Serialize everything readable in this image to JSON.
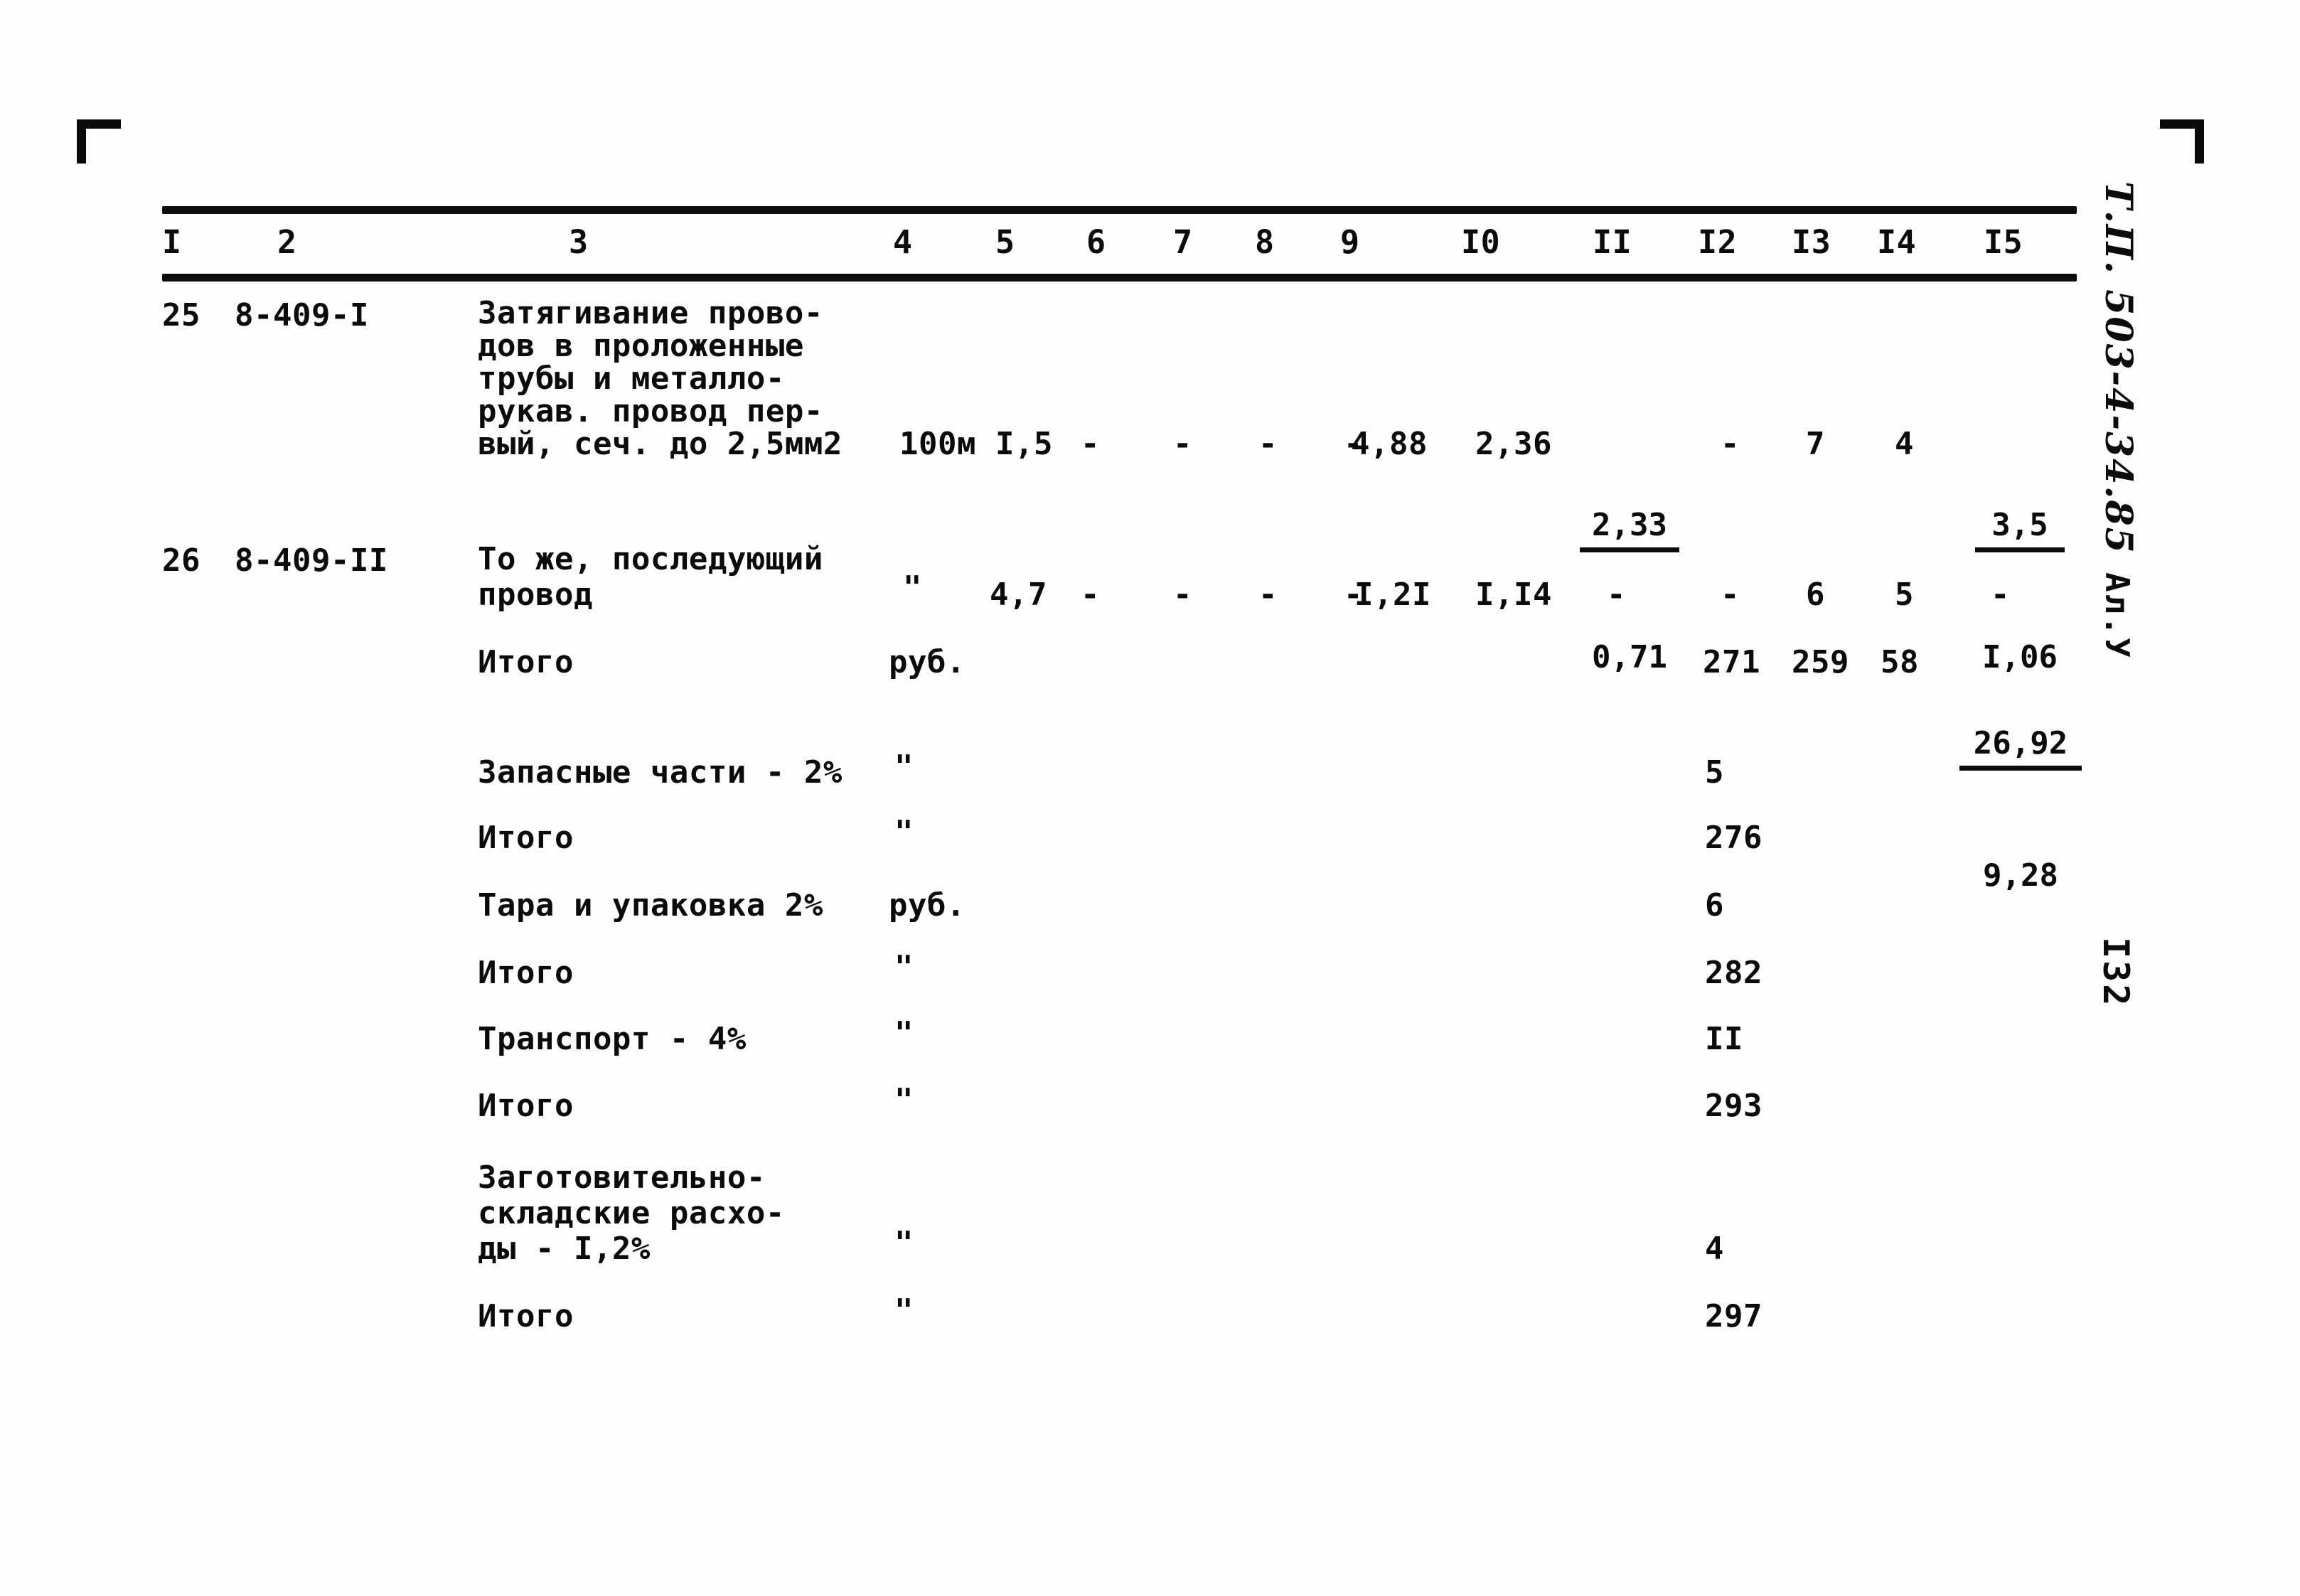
{
  "document": {
    "stamp": "Т.П. 503-4-34.85",
    "sheet_label": "Ал.У",
    "page_number": "I32"
  },
  "table": {
    "column_headers": [
      "I",
      "2",
      "3",
      "4",
      "5",
      "6",
      "7",
      "8",
      "9",
      "I0",
      "II",
      "I2",
      "I3",
      "I4",
      "I5"
    ],
    "rows": [
      {
        "no": "25",
        "code": "8-409-I",
        "description_lines": [
          "Затягивание прово-",
          "дов в проложенные",
          "трубы и металло-",
          "рукав. провод пер-",
          "вый, сеч. до 2,5мм2"
        ],
        "unit": "100м",
        "c5": "I,5",
        "c6": "-",
        "c7": "-",
        "c8": "-",
        "c9": "-",
        "c10": "4,88",
        "c11": "2,36",
        "c12_num": "2,33",
        "c12_den": "0,71",
        "c13": "-",
        "c14": "7",
        "c15": "4",
        "c16_num": "3,5",
        "c16_den": "I,06"
      },
      {
        "no": "26",
        "code": "8-409-II",
        "description_lines": [
          "То же, последующий",
          "провод"
        ],
        "unit": "\"",
        "c5": "4,7",
        "c6": "-",
        "c7": "-",
        "c8": "-",
        "c9": "-",
        "c10": "I,2I",
        "c11": "I,I4",
        "c12": "-",
        "c13": "-",
        "c14": "6",
        "c15": "5",
        "c16": "-"
      }
    ],
    "summary_rows": [
      {
        "label": "Итого",
        "unit": "руб.",
        "c12": "271",
        "c13": "259",
        "c14": "58",
        "c15_num": "26,92",
        "c15_den": "9,28"
      },
      {
        "label": "Запасные части - 2%",
        "unit": "\"",
        "c12": "5"
      },
      {
        "label": "Итого",
        "unit": "\"",
        "c12": "276"
      },
      {
        "label": "Тара и упаковка 2%",
        "unit": "руб.",
        "c12": "6"
      },
      {
        "label": "Итого",
        "unit": "\"",
        "c12": "282"
      },
      {
        "label": "Транспорт - 4%",
        "unit": "\"",
        "c12": "II"
      },
      {
        "label": "Итого",
        "unit": "\"",
        "c12": "293"
      },
      {
        "label_lines": [
          "Заготовительно-",
          "складские расхо-",
          "ды - I,2%"
        ],
        "unit": "\"",
        "c12": "4"
      },
      {
        "label": "Итого",
        "unit": "\"",
        "c12": "297"
      }
    ]
  }
}
